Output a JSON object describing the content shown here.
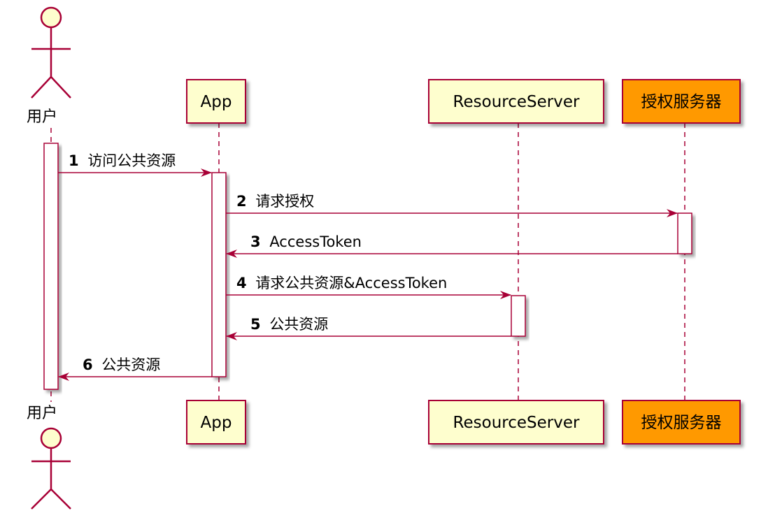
{
  "participants": [
    {
      "id": "user",
      "label": "用户",
      "kind": "actor"
    },
    {
      "id": "app",
      "label": "App",
      "kind": "box"
    },
    {
      "id": "rs",
      "label": "ResourceServer",
      "kind": "box"
    },
    {
      "id": "auth",
      "label": "授权服务器",
      "kind": "box",
      "highlight": true
    }
  ],
  "messages": [
    {
      "num": "1",
      "text": "访问公共资源"
    },
    {
      "num": "2",
      "text": "请求授权"
    },
    {
      "num": "3",
      "text": "AccessToken"
    },
    {
      "num": "4",
      "text": "请求公共资源&AccessToken"
    },
    {
      "num": "5",
      "text": "公共资源"
    },
    {
      "num": "6",
      "text": "公共资源"
    }
  ],
  "colors": {
    "line": "#A80036",
    "box_fill": "#FEFECE",
    "highlight_fill": "#FF9900",
    "activation_fill": "#FFFFFF"
  }
}
